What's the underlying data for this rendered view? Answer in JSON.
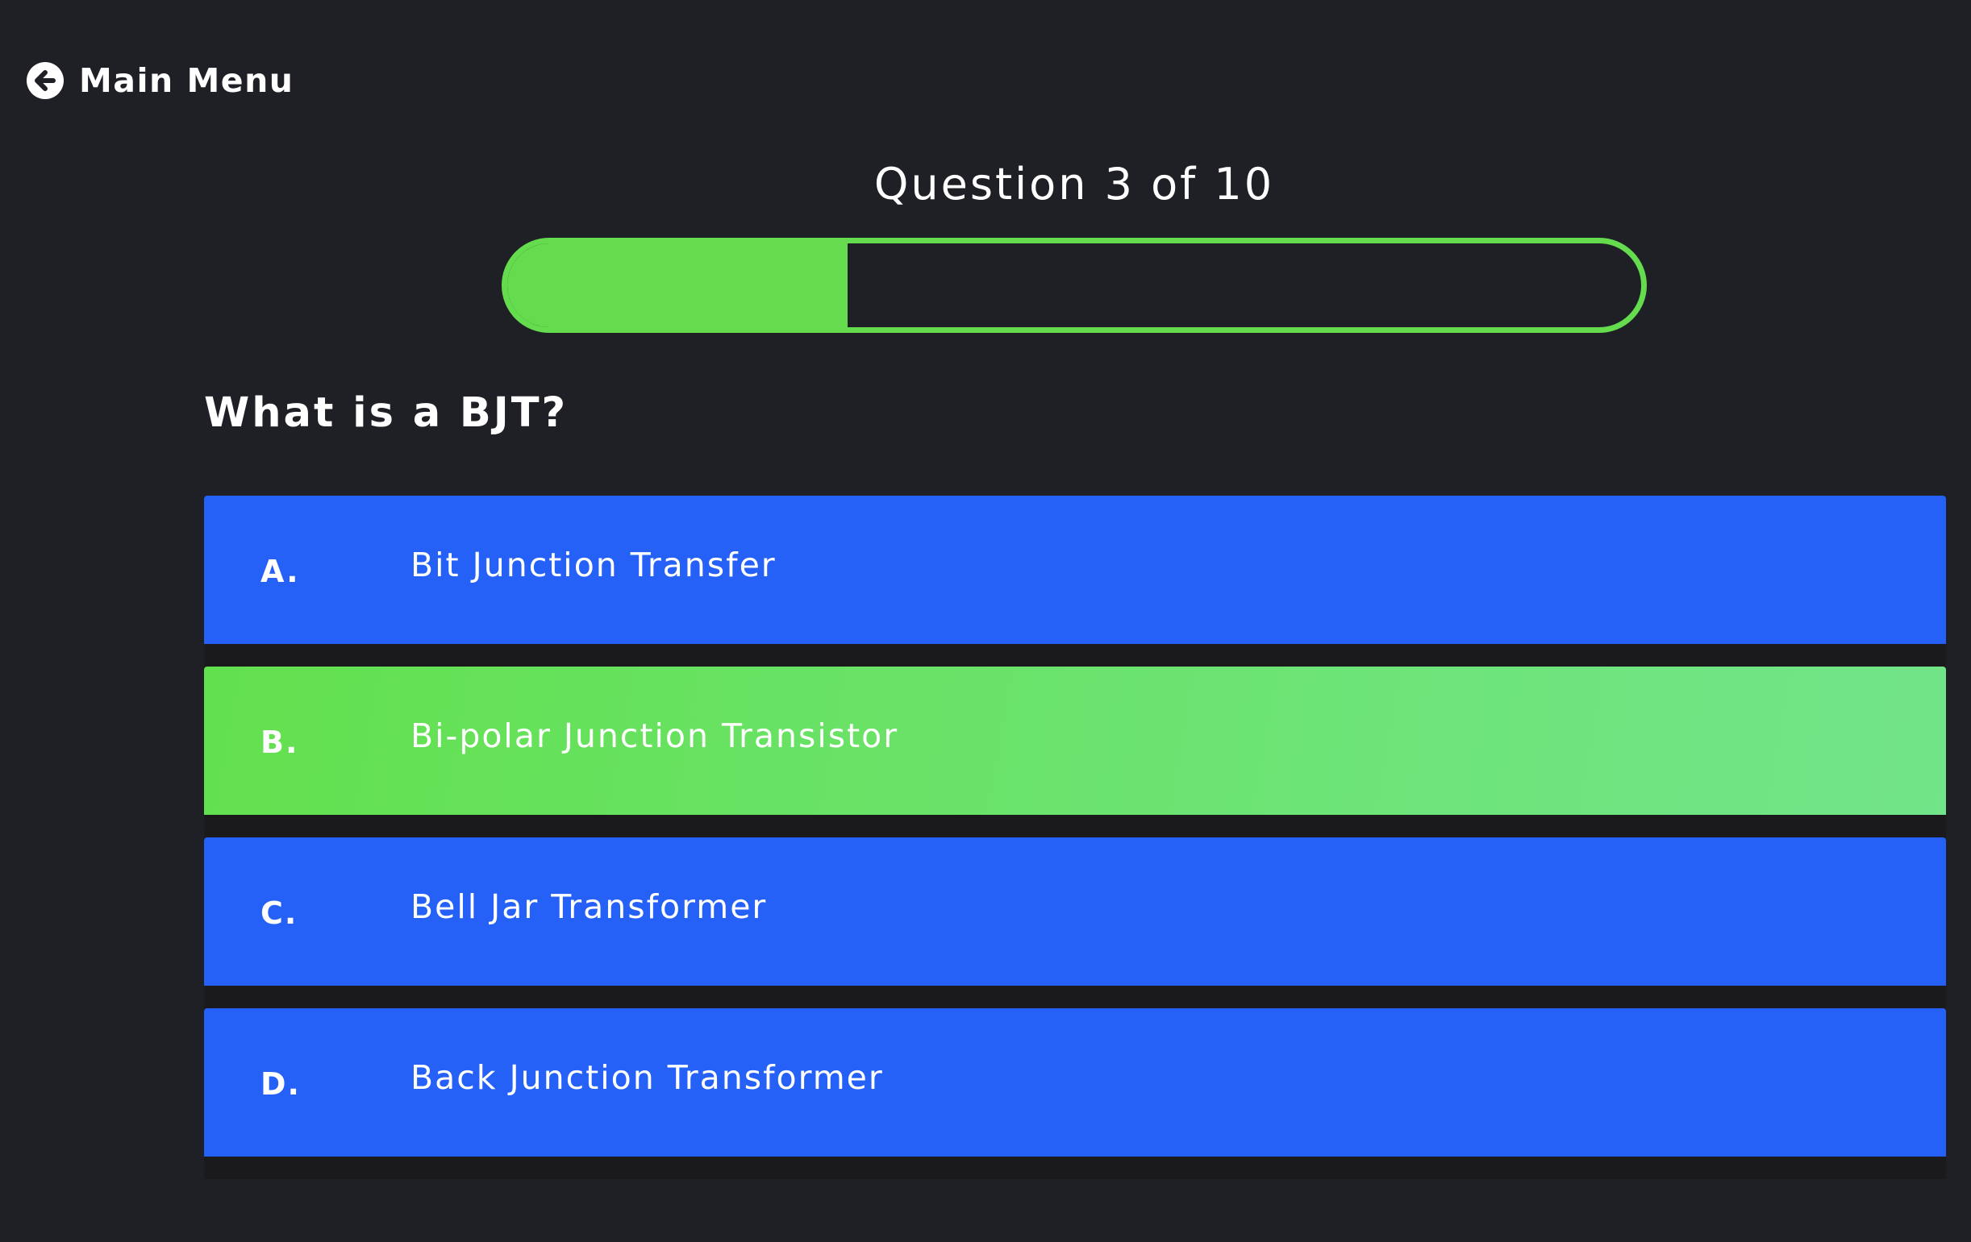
{
  "nav": {
    "back_label": "Main Menu",
    "back_icon": "arrow-left-circle-icon"
  },
  "quiz": {
    "counter_text": "Question 3 of 10",
    "current_question": 3,
    "total_questions": 10,
    "progress_fraction": 0.3,
    "question_text": "What is a BJT?"
  },
  "answers": [
    {
      "letter": "A.",
      "text": "Bit Junction Transfer",
      "selected": false
    },
    {
      "letter": "B.",
      "text": "Bi-polar Junction Transistor",
      "selected": true
    },
    {
      "letter": "C.",
      "text": "Bell Jar Transformer",
      "selected": false
    },
    {
      "letter": "D.",
      "text": "Back Junction Transformer",
      "selected": false
    }
  ],
  "colors": {
    "background": "#1f2026",
    "accent_green": "#64dc4e",
    "answer_blue": "#2561f7",
    "text": "#ffffff"
  }
}
